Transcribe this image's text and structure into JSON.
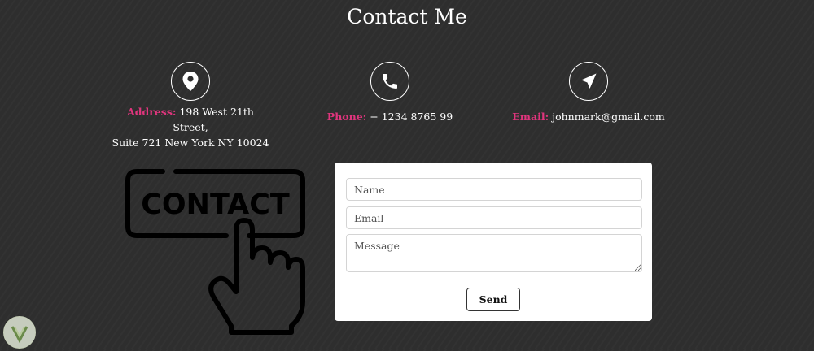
{
  "page": {
    "title": "Contact Me"
  },
  "contact_info": {
    "address": {
      "label": "Address:",
      "line1": "198 West 21th Street,",
      "line2": "Suite 721 New York NY 10024"
    },
    "phone": {
      "label": "Phone:",
      "value": "+ 1234 8765 99"
    },
    "email": {
      "label": "Email:",
      "value": "johnmark@gmail.com"
    }
  },
  "illustration": {
    "text": "CONTACT"
  },
  "form": {
    "name_placeholder": "Name",
    "email_placeholder": "Email",
    "message_placeholder": "Message",
    "send_label": "Send"
  },
  "colors": {
    "accent": "#e0357d",
    "background": "#2e2e2e",
    "card": "#ffffff"
  },
  "icons": [
    "map-pin-icon",
    "phone-icon",
    "paper-plane-icon",
    "hand-pointer-icon",
    "badge-logo-icon"
  ]
}
